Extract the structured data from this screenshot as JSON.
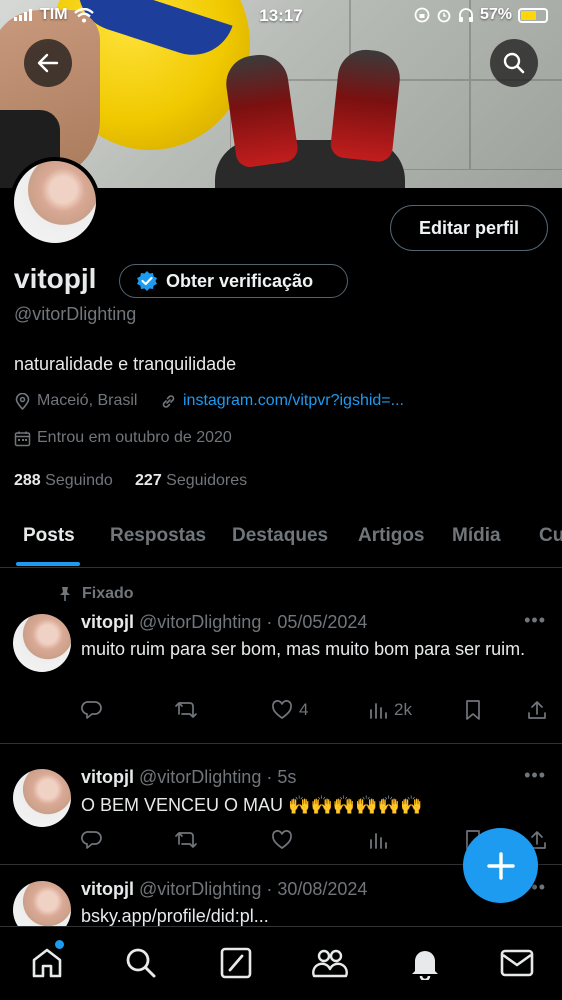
{
  "status_bar": {
    "carrier": "TIM",
    "time": "13:17",
    "battery": "57%",
    "battery_level": 0.57
  },
  "profile": {
    "name": "vitopjl",
    "handle": "@vitorDlighting",
    "bio": "naturalidade e tranquilidade",
    "location": "Maceió, Brasil",
    "website": "instagram.com/vitpvr?igshid=...",
    "joined": "Entrou em outubro de 2020",
    "following_count": "288",
    "following_label": "Seguindo",
    "followers_count": "227",
    "followers_label": "Seguidores",
    "edit_button": "Editar perfil",
    "verify_button": "Obter verificação"
  },
  "tabs": [
    "Posts",
    "Respostas",
    "Destaques",
    "Artigos",
    "Mídia",
    "Cu"
  ],
  "active_tab": "Posts",
  "tweets": [
    {
      "pinned_label": "Fixado",
      "author": "vitopjl",
      "handle": "@vitorDlighting",
      "date": "· 05/05/2024",
      "text": "muito ruim para ser bom, mas muito bom para ser ruim.",
      "likes": "4",
      "views": "2k"
    },
    {
      "author": "vitopjl",
      "handle": "@vitorDlighting",
      "date": "· 5s",
      "text": "O BEM VENCEU O MAU 🙌🙌🙌🙌🙌🙌"
    },
    {
      "author": "vitopjl",
      "handle": "@vitorDlighting",
      "date": "· 30/08/2024",
      "text": "bsky.app/profile/did:pl..."
    }
  ],
  "colors": {
    "accent": "#1d9bf0",
    "muted": "#71767b",
    "text": "#e7e9ea",
    "border": "#2f3336"
  }
}
